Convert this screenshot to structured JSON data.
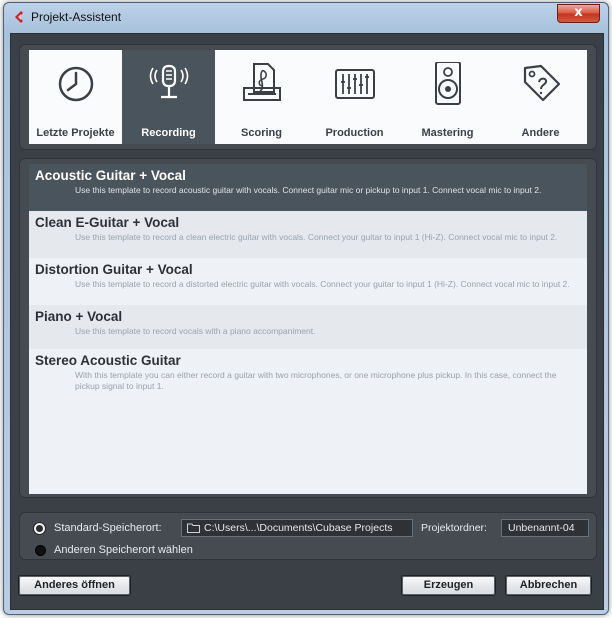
{
  "window": {
    "title": "Projekt-Assistent",
    "close_label": "x"
  },
  "categories": [
    {
      "label": "Letzte Projekte",
      "icon": "clock-icon",
      "active": false
    },
    {
      "label": "Recording",
      "icon": "microphone-icon",
      "active": true
    },
    {
      "label": "Scoring",
      "icon": "sheet-music-icon",
      "active": false
    },
    {
      "label": "Production",
      "icon": "mixer-faders-icon",
      "active": false
    },
    {
      "label": "Mastering",
      "icon": "speaker-icon",
      "active": false
    },
    {
      "label": "Andere",
      "icon": "tag-icon",
      "active": false
    }
  ],
  "templates": [
    {
      "title": "Acoustic Guitar + Vocal",
      "description": "Use this template to record acoustic guitar with vocals. Connect guitar mic or pickup to input  1. Connect vocal mic to input 2.",
      "selected": true
    },
    {
      "title": "Clean E-Guitar + Vocal",
      "description": "Use this template to record a clean electric guitar with vocals. Connect your guitar to input  1 (Hi-Z). Connect vocal mic to input 2.",
      "selected": false
    },
    {
      "title": "Distortion Guitar + Vocal",
      "description": "Use this template to record a distorted electric guitar with vocals. Connect your guitar to input  1 (Hi-Z). Connect vocal mic to input 2.",
      "selected": false
    },
    {
      "title": "Piano + Vocal",
      "description": "Use this template to record vocals with a piano accompaniment.",
      "selected": false
    },
    {
      "title": "Stereo Acoustic Guitar",
      "description": "With this template you can either record a guitar with two microphones, or one microphone plus pickup. In this case, connect the pickup signal to input 1.",
      "selected": false
    }
  ],
  "location": {
    "standard_label": "Standard-Speicherort:",
    "standard_path": "C:\\Users\\...\\Documents\\Cubase Projects",
    "project_folder_label": "Projektordner:",
    "project_folder_value": "Unbenannt-04",
    "other_label": "Anderen Speicherort wählen"
  },
  "buttons": {
    "open_other": "Anderes öffnen",
    "create": "Erzeugen",
    "cancel": "Abbrechen"
  },
  "colors": {
    "selected_background": "#4a545c",
    "panel_background": "#3a4046",
    "close_button": "#c2331c"
  }
}
